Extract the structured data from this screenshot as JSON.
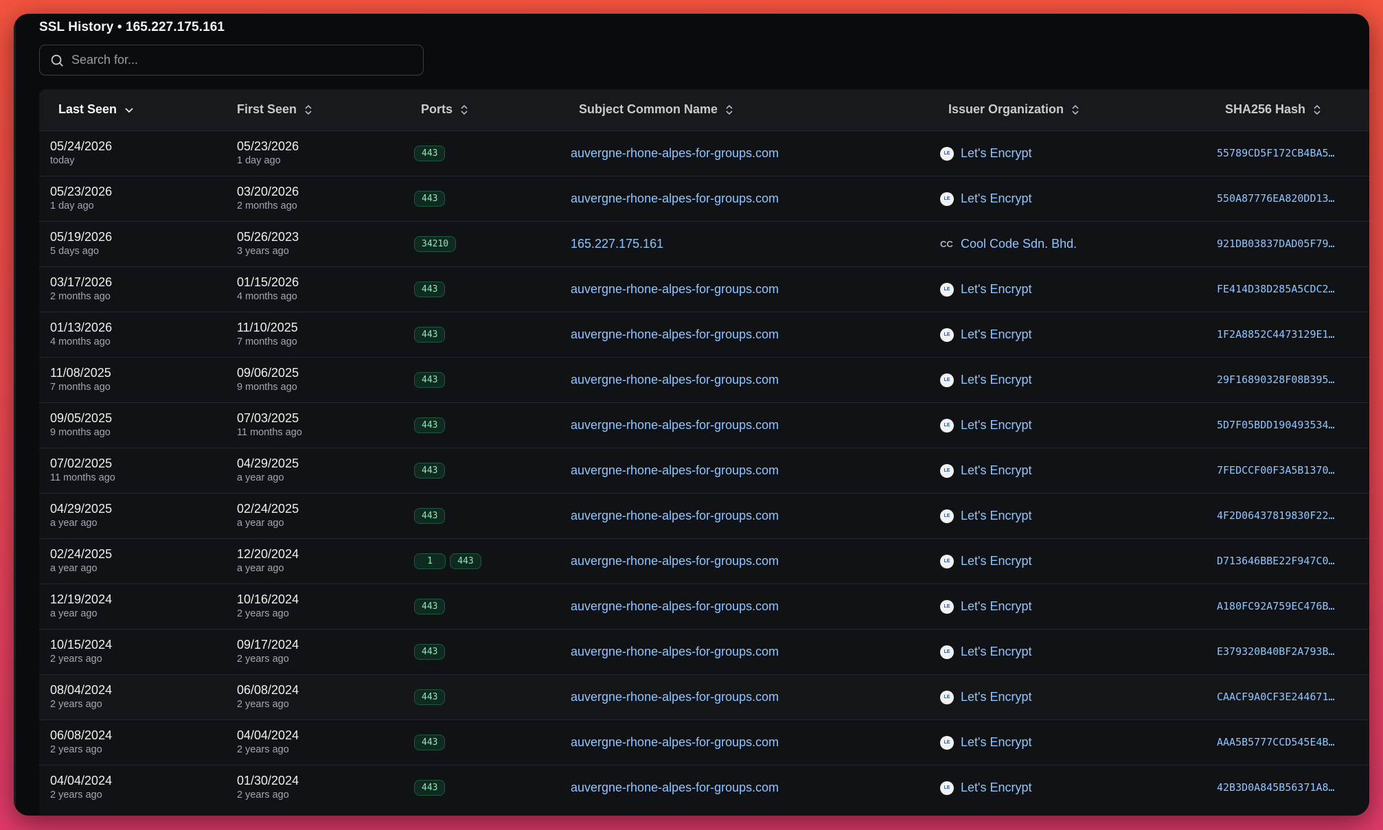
{
  "title": "SSL History • 165.227.175.161",
  "search": {
    "placeholder": "Search for..."
  },
  "columns": {
    "last_seen": "Last Seen",
    "first_seen": "First Seen",
    "ports": "Ports",
    "subject_cn": "Subject Common Name",
    "issuer_org": "Issuer Organization",
    "sha256": "SHA256 Hash"
  },
  "sort": {
    "active_column": "last_seen",
    "direction": "desc"
  },
  "colors": {
    "accent_link": "#8ec5ff",
    "port_badge": "#8de8b6",
    "background": "#0a0b0d"
  },
  "rows": [
    {
      "last": "05/24/2026",
      "last_rel": "today",
      "first": "05/23/2026",
      "first_rel": "1 day ago",
      "ports": [
        "443"
      ],
      "cn": "auvergne-rhone-alpes-for-groups.com",
      "org": "Let's Encrypt",
      "org_icon": "lets-encrypt-logo",
      "hash": "55789CD5F172CB4BA5…"
    },
    {
      "last": "05/23/2026",
      "last_rel": "1 day ago",
      "first": "03/20/2026",
      "first_rel": "2 months ago",
      "ports": [
        "443"
      ],
      "cn": "auvergne-rhone-alpes-for-groups.com",
      "org": "Let's Encrypt",
      "org_icon": "lets-encrypt-logo",
      "hash": "550A87776EA820DD13…"
    },
    {
      "last": "05/19/2026",
      "last_rel": "5 days ago",
      "first": "05/26/2023",
      "first_rel": "3 years ago",
      "ports": [
        "34210"
      ],
      "cn": "165.227.175.161",
      "org": "Cool Code Sdn. Bhd.",
      "org_icon": "cc",
      "hash": "921DB03837DAD05F79…"
    },
    {
      "last": "03/17/2026",
      "last_rel": "2 months ago",
      "first": "01/15/2026",
      "first_rel": "4 months ago",
      "ports": [
        "443"
      ],
      "cn": "auvergne-rhone-alpes-for-groups.com",
      "org": "Let's Encrypt",
      "org_icon": "lets-encrypt-logo",
      "hash": "FE414D38D285A5CDC2…"
    },
    {
      "last": "01/13/2026",
      "last_rel": "4 months ago",
      "first": "11/10/2025",
      "first_rel": "7 months ago",
      "ports": [
        "443"
      ],
      "cn": "auvergne-rhone-alpes-for-groups.com",
      "org": "Let's Encrypt",
      "org_icon": "lets-encrypt-logo",
      "hash": "1F2A8852C4473129E1…"
    },
    {
      "last": "11/08/2025",
      "last_rel": "7 months ago",
      "first": "09/06/2025",
      "first_rel": "9 months ago",
      "ports": [
        "443"
      ],
      "cn": "auvergne-rhone-alpes-for-groups.com",
      "org": "Let's Encrypt",
      "org_icon": "lets-encrypt-logo",
      "hash": "29F16890328F08B395…"
    },
    {
      "last": "09/05/2025",
      "last_rel": "9 months ago",
      "first": "07/03/2025",
      "first_rel": "11 months ago",
      "ports": [
        "443"
      ],
      "cn": "auvergne-rhone-alpes-for-groups.com",
      "org": "Let's Encrypt",
      "org_icon": "lets-encrypt-logo",
      "hash": "5D7F05BDD190493534…"
    },
    {
      "last": "07/02/2025",
      "last_rel": "11 months ago",
      "first": "04/29/2025",
      "first_rel": "a year ago",
      "ports": [
        "443"
      ],
      "cn": "auvergne-rhone-alpes-for-groups.com",
      "org": "Let's Encrypt",
      "org_icon": "lets-encrypt-logo",
      "hash": "7FEDCCF00F3A5B1370…"
    },
    {
      "last": "04/29/2025",
      "last_rel": "a year ago",
      "first": "02/24/2025",
      "first_rel": "a year ago",
      "ports": [
        "443"
      ],
      "cn": "auvergne-rhone-alpes-for-groups.com",
      "org": "Let's Encrypt",
      "org_icon": "lets-encrypt-logo",
      "hash": "4F2D06437819830F22…"
    },
    {
      "last": "02/24/2025",
      "last_rel": "a year ago",
      "first": "12/20/2024",
      "first_rel": "a year ago",
      "ports": [
        "1",
        "443"
      ],
      "cn": "auvergne-rhone-alpes-for-groups.com",
      "org": "Let's Encrypt",
      "org_icon": "lets-encrypt-logo",
      "hash": "D713646BBE22F947C0…"
    },
    {
      "last": "12/19/2024",
      "last_rel": "a year ago",
      "first": "10/16/2024",
      "first_rel": "2 years ago",
      "ports": [
        "443"
      ],
      "cn": "auvergne-rhone-alpes-for-groups.com",
      "org": "Let's Encrypt",
      "org_icon": "lets-encrypt-logo",
      "hash": "A180FC92A759EC476B…"
    },
    {
      "last": "10/15/2024",
      "last_rel": "2 years ago",
      "first": "09/17/2024",
      "first_rel": "2 years ago",
      "ports": [
        "443"
      ],
      "cn": "auvergne-rhone-alpes-for-groups.com",
      "org": "Let's Encrypt",
      "org_icon": "lets-encrypt-logo",
      "hash": "E379320B40BF2A793B…"
    },
    {
      "last": "08/04/2024",
      "last_rel": "2 years ago",
      "first": "06/08/2024",
      "first_rel": "2 years ago",
      "ports": [
        "443"
      ],
      "cn": "auvergne-rhone-alpes-for-groups.com",
      "org": "Let's Encrypt",
      "org_icon": "lets-encrypt-logo",
      "hash": "CAACF9A0CF3E244671…"
    },
    {
      "last": "06/08/2024",
      "last_rel": "2 years ago",
      "first": "04/04/2024",
      "first_rel": "2 years ago",
      "ports": [
        "443"
      ],
      "cn": "auvergne-rhone-alpes-for-groups.com",
      "org": "Let's Encrypt",
      "org_icon": "lets-encrypt-logo",
      "hash": "AAA5B5777CCD545E4B…"
    },
    {
      "last": "04/04/2024",
      "last_rel": "2 years ago",
      "first": "01/30/2024",
      "first_rel": "2 years ago",
      "ports": [
        "443"
      ],
      "cn": "auvergne-rhone-alpes-for-groups.com",
      "org": "Let's Encrypt",
      "org_icon": "lets-encrypt-logo",
      "hash": "42B3D0A845B56371A8…"
    }
  ]
}
